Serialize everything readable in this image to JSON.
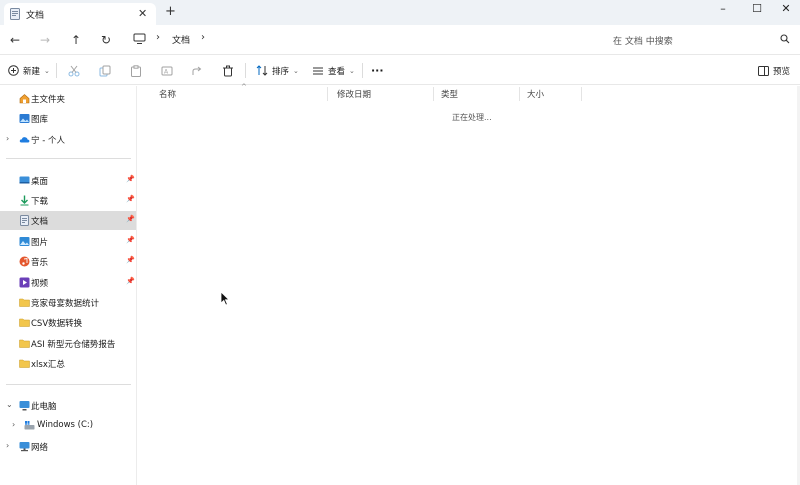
{
  "tab": {
    "title": "文档",
    "close_glyph": "✕",
    "new_glyph": "+"
  },
  "window": {
    "minimize": "–",
    "maximize": "☐",
    "close": "✕"
  },
  "nav": {
    "back": "←",
    "forward": "→",
    "up": "↑",
    "refresh": "↻",
    "breadcrumb": {
      "current": "文档",
      "separator": "›"
    },
    "search_placeholder": "在 文档 中搜索"
  },
  "commands": {
    "new_label": "新建",
    "sort_label": "排序",
    "view_label": "查看",
    "more_label": "···",
    "preview_label": "预览",
    "chevron": "⌄"
  },
  "sidebar": {
    "top": [
      {
        "label": "主文件夹",
        "icon": "home-icon"
      },
      {
        "label": "图库",
        "icon": "gallery-icon"
      },
      {
        "label": "宁 - 个人",
        "icon": "onedrive-icon",
        "expand": "›"
      }
    ],
    "quick": [
      {
        "label": "桌面",
        "icon": "desktop-icon",
        "pin": "📌"
      },
      {
        "label": "下载",
        "icon": "download-icon",
        "pin": "📌"
      },
      {
        "label": "文档",
        "icon": "document-icon",
        "pin": "📌",
        "selected": true
      },
      {
        "label": "图片",
        "icon": "pictures-icon",
        "pin": "📌"
      },
      {
        "label": "音乐",
        "icon": "music-icon",
        "pin": "📌"
      },
      {
        "label": "视频",
        "icon": "video-icon",
        "pin": "📌"
      },
      {
        "label": "竞家母宴数据统计",
        "icon": "folder-icon"
      },
      {
        "label": "CSV数据转换",
        "icon": "folder-icon"
      },
      {
        "label": "ASI 新型元仓储势报告",
        "icon": "folder-icon"
      },
      {
        "label": "xlsx汇总",
        "icon": "folder-icon"
      }
    ],
    "devices": [
      {
        "label": "此电脑",
        "icon": "computer-icon",
        "expand": "⌄"
      },
      {
        "label": "Windows (C:)",
        "icon": "drive-icon",
        "expand": "›"
      },
      {
        "label": "网络",
        "icon": "network-icon",
        "expand": "›"
      }
    ]
  },
  "columns": [
    "名称",
    "修改日期",
    "类型",
    "大小"
  ],
  "sort_caret": "^",
  "status": {
    "working": "正在处理..."
  },
  "colors": {
    "folder": "#f2c64c",
    "accent": "#0067c0",
    "selected": "#dcdcdc"
  }
}
